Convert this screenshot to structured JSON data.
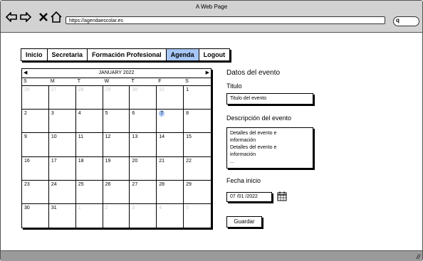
{
  "window": {
    "title": "A Web Page",
    "url": "https://agendaescolar.es"
  },
  "nav": [
    "Inicio",
    "Secretaria",
    "Formación Profesional",
    "Agenda",
    "Logout"
  ],
  "nav_active": "Agenda",
  "calendar": {
    "month": "JANUARY 2022",
    "days_of_week": [
      "S",
      "M",
      "T",
      "W",
      "T",
      "F",
      "S"
    ],
    "weeks": [
      [
        "26",
        "27",
        "28",
        "29",
        "30",
        "31",
        "1"
      ],
      [
        "2",
        "3",
        "4",
        "5",
        "6",
        "7",
        "8"
      ],
      [
        "9",
        "10",
        "11",
        "12",
        "13",
        "14",
        "15"
      ],
      [
        "16",
        "17",
        "18",
        "19",
        "20",
        "21",
        "22"
      ],
      [
        "23",
        "24",
        "25",
        "26",
        "27",
        "28",
        "29"
      ],
      [
        "30",
        "31",
        "1",
        "2",
        "3",
        "4",
        "5"
      ]
    ],
    "selected_day": "7"
  },
  "form": {
    "heading": "Datos del evento",
    "titulo_label": "Titulo",
    "titulo_value": "Titulo del evento",
    "descripcion_label": "Descripción del evento",
    "descripcion_lines": [
      "Detalles del evento e",
      "información",
      "Detalles del evento e",
      "información",
      "..."
    ],
    "fecha_label": "Fecha inicio",
    "fecha_value": "07 /01 /2022",
    "guardar_label": "Guardar"
  }
}
